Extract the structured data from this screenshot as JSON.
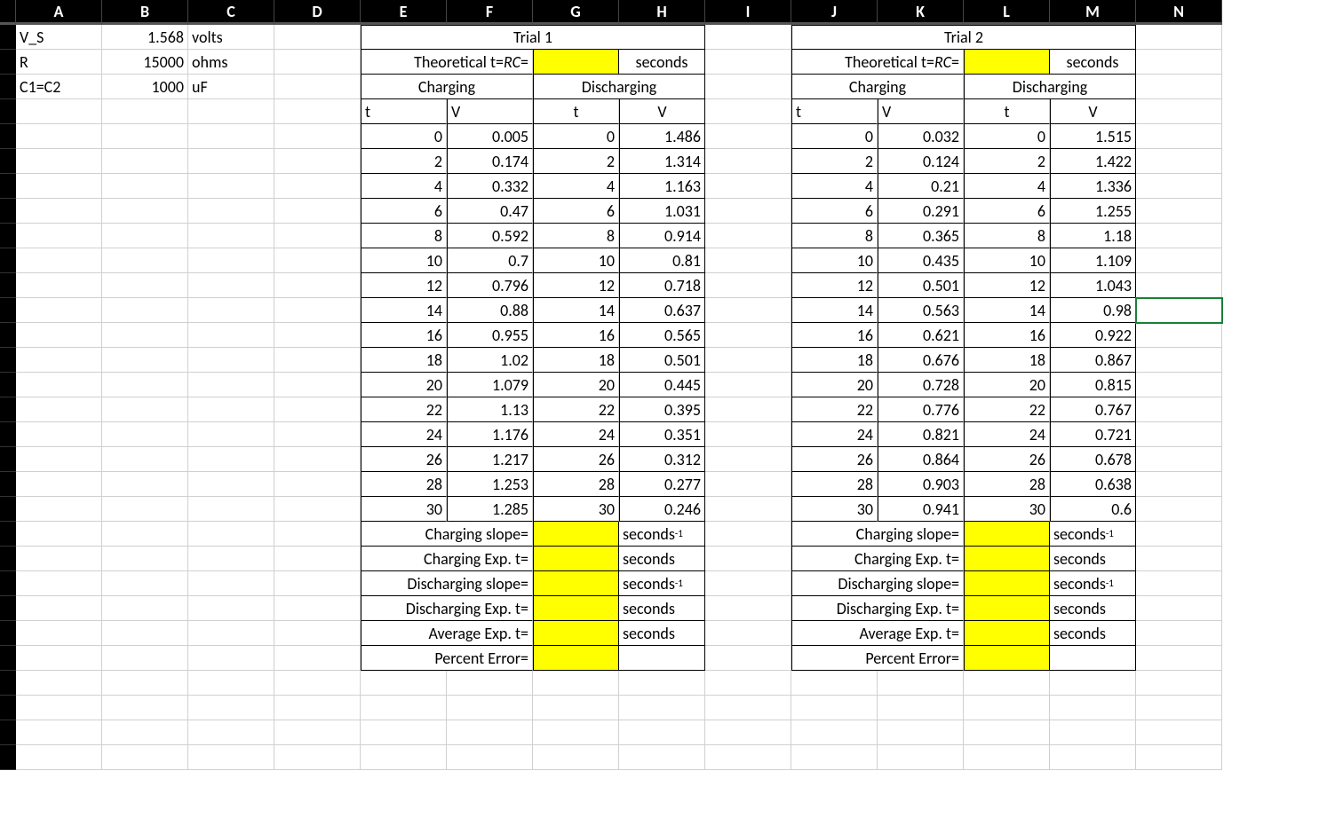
{
  "columns": [
    "A",
    "B",
    "C",
    "D",
    "E",
    "F",
    "G",
    "H",
    "I",
    "J",
    "K",
    "L",
    "M",
    "N"
  ],
  "left_labels": {
    "vs_label": "V_S",
    "vs_value": "1.568",
    "vs_unit": "volts",
    "r_label": "R",
    "r_value": "15000",
    "r_unit": "ohms",
    "c_label": "C1=C2",
    "c_value": "1000",
    "c_unit": "uF"
  },
  "common": {
    "theoretical_label": "Theoretical t=RC=",
    "seconds": "seconds",
    "seconds_inv": "seconds⁻¹",
    "charging": "Charging",
    "discharging": "Discharging",
    "t_hdr": "t",
    "v_hdr": "V",
    "charging_slope": "Charging slope=",
    "charging_exp": "Charging Exp. t=",
    "discharging_slope": "Discharging slope=",
    "discharging_exp": "Discharging Exp. t=",
    "average_exp": "Average Exp. t=",
    "percent_error": "Percent Error="
  },
  "trial1": {
    "title": "Trial 1",
    "charging": [
      {
        "t": "0",
        "v": "0.005"
      },
      {
        "t": "2",
        "v": "0.174"
      },
      {
        "t": "4",
        "v": "0.332"
      },
      {
        "t": "6",
        "v": "0.47"
      },
      {
        "t": "8",
        "v": "0.592"
      },
      {
        "t": "10",
        "v": "0.7"
      },
      {
        "t": "12",
        "v": "0.796"
      },
      {
        "t": "14",
        "v": "0.88"
      },
      {
        "t": "16",
        "v": "0.955"
      },
      {
        "t": "18",
        "v": "1.02"
      },
      {
        "t": "20",
        "v": "1.079"
      },
      {
        "t": "22",
        "v": "1.13"
      },
      {
        "t": "24",
        "v": "1.176"
      },
      {
        "t": "26",
        "v": "1.217"
      },
      {
        "t": "28",
        "v": "1.253"
      },
      {
        "t": "30",
        "v": "1.285"
      }
    ],
    "discharging": [
      {
        "t": "0",
        "v": "1.486"
      },
      {
        "t": "2",
        "v": "1.314"
      },
      {
        "t": "4",
        "v": "1.163"
      },
      {
        "t": "6",
        "v": "1.031"
      },
      {
        "t": "8",
        "v": "0.914"
      },
      {
        "t": "10",
        "v": "0.81"
      },
      {
        "t": "12",
        "v": "0.718"
      },
      {
        "t": "14",
        "v": "0.637"
      },
      {
        "t": "16",
        "v": "0.565"
      },
      {
        "t": "18",
        "v": "0.501"
      },
      {
        "t": "20",
        "v": "0.445"
      },
      {
        "t": "22",
        "v": "0.395"
      },
      {
        "t": "24",
        "v": "0.351"
      },
      {
        "t": "26",
        "v": "0.312"
      },
      {
        "t": "28",
        "v": "0.277"
      },
      {
        "t": "30",
        "v": "0.246"
      }
    ]
  },
  "trial2": {
    "title": "Trial 2",
    "charging": [
      {
        "t": "0",
        "v": "0.032"
      },
      {
        "t": "2",
        "v": "0.124"
      },
      {
        "t": "4",
        "v": "0.21"
      },
      {
        "t": "6",
        "v": "0.291"
      },
      {
        "t": "8",
        "v": "0.365"
      },
      {
        "t": "10",
        "v": "0.435"
      },
      {
        "t": "12",
        "v": "0.501"
      },
      {
        "t": "14",
        "v": "0.563"
      },
      {
        "t": "16",
        "v": "0.621"
      },
      {
        "t": "18",
        "v": "0.676"
      },
      {
        "t": "20",
        "v": "0.728"
      },
      {
        "t": "22",
        "v": "0.776"
      },
      {
        "t": "24",
        "v": "0.821"
      },
      {
        "t": "26",
        "v": "0.864"
      },
      {
        "t": "28",
        "v": "0.903"
      },
      {
        "t": "30",
        "v": "0.941"
      }
    ],
    "discharging": [
      {
        "t": "0",
        "v": "1.515"
      },
      {
        "t": "2",
        "v": "1.422"
      },
      {
        "t": "4",
        "v": "1.336"
      },
      {
        "t": "6",
        "v": "1.255"
      },
      {
        "t": "8",
        "v": "1.18"
      },
      {
        "t": "10",
        "v": "1.109"
      },
      {
        "t": "12",
        "v": "1.043"
      },
      {
        "t": "14",
        "v": "0.98"
      },
      {
        "t": "16",
        "v": "0.922"
      },
      {
        "t": "18",
        "v": "0.867"
      },
      {
        "t": "20",
        "v": "0.815"
      },
      {
        "t": "22",
        "v": "0.767"
      },
      {
        "t": "24",
        "v": "0.721"
      },
      {
        "t": "26",
        "v": "0.678"
      },
      {
        "t": "28",
        "v": "0.638"
      },
      {
        "t": "30",
        "v": "0.6"
      }
    ]
  },
  "chart_data": {
    "type": "table",
    "title": "RC Circuit Charging/Discharging Data",
    "parameters": {
      "V_S_volts": 1.568,
      "R_ohms": 15000,
      "C_uF": 1000
    },
    "series": [
      {
        "name": "Trial 1 Charging",
        "x_label": "t (s)",
        "y_label": "V (volts)",
        "x": [
          0,
          2,
          4,
          6,
          8,
          10,
          12,
          14,
          16,
          18,
          20,
          22,
          24,
          26,
          28,
          30
        ],
        "y": [
          0.005,
          0.174,
          0.332,
          0.47,
          0.592,
          0.7,
          0.796,
          0.88,
          0.955,
          1.02,
          1.079,
          1.13,
          1.176,
          1.217,
          1.253,
          1.285
        ]
      },
      {
        "name": "Trial 1 Discharging",
        "x_label": "t (s)",
        "y_label": "V (volts)",
        "x": [
          0,
          2,
          4,
          6,
          8,
          10,
          12,
          14,
          16,
          18,
          20,
          22,
          24,
          26,
          28,
          30
        ],
        "y": [
          1.486,
          1.314,
          1.163,
          1.031,
          0.914,
          0.81,
          0.718,
          0.637,
          0.565,
          0.501,
          0.445,
          0.395,
          0.351,
          0.312,
          0.277,
          0.246
        ]
      },
      {
        "name": "Trial 2 Charging",
        "x_label": "t (s)",
        "y_label": "V (volts)",
        "x": [
          0,
          2,
          4,
          6,
          8,
          10,
          12,
          14,
          16,
          18,
          20,
          22,
          24,
          26,
          28,
          30
        ],
        "y": [
          0.032,
          0.124,
          0.21,
          0.291,
          0.365,
          0.435,
          0.501,
          0.563,
          0.621,
          0.676,
          0.728,
          0.776,
          0.821,
          0.864,
          0.903,
          0.941
        ]
      },
      {
        "name": "Trial 2 Discharging",
        "x_label": "t (s)",
        "y_label": "V (volts)",
        "x": [
          0,
          2,
          4,
          6,
          8,
          10,
          12,
          14,
          16,
          18,
          20,
          22,
          24,
          26,
          28,
          30
        ],
        "y": [
          1.515,
          1.422,
          1.336,
          1.255,
          1.18,
          1.109,
          1.043,
          0.98,
          0.922,
          0.867,
          0.815,
          0.767,
          0.721,
          0.678,
          0.638,
          0.6
        ]
      }
    ]
  }
}
